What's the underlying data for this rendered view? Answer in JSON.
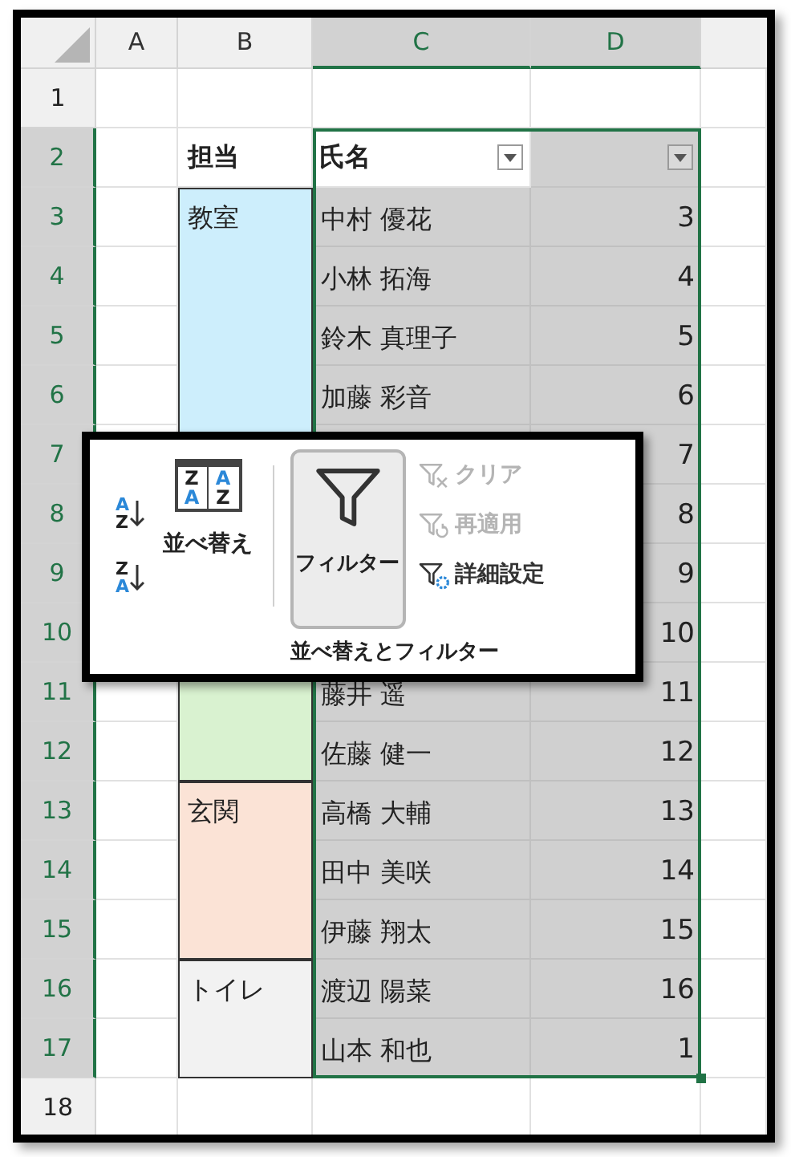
{
  "columns": [
    {
      "label": "A",
      "selected": false
    },
    {
      "label": "B",
      "selected": false
    },
    {
      "label": "C",
      "selected": true
    },
    {
      "label": "D",
      "selected": true
    }
  ],
  "rows": [
    {
      "label": "1",
      "selected": false
    },
    {
      "label": "2",
      "selected": true
    },
    {
      "label": "3",
      "selected": true
    },
    {
      "label": "4",
      "selected": true
    },
    {
      "label": "5",
      "selected": true
    },
    {
      "label": "6",
      "selected": true
    },
    {
      "label": "7",
      "selected": true
    },
    {
      "label": "8",
      "selected": true
    },
    {
      "label": "9",
      "selected": true
    },
    {
      "label": "10",
      "selected": true
    },
    {
      "label": "11",
      "selected": true
    },
    {
      "label": "12",
      "selected": true
    },
    {
      "label": "13",
      "selected": true
    },
    {
      "label": "14",
      "selected": true
    },
    {
      "label": "15",
      "selected": true
    },
    {
      "label": "16",
      "selected": true
    },
    {
      "label": "17",
      "selected": true
    },
    {
      "label": "18",
      "selected": false
    }
  ],
  "table_header": {
    "column_b": "担当",
    "column_c": "氏名"
  },
  "groups": [
    {
      "label": "教室",
      "color": "#cdeefc",
      "records": [
        {
          "name": "中村 優花",
          "number": "3"
        },
        {
          "name": "小林 拓海",
          "number": "4"
        },
        {
          "name": "鈴木 真理子",
          "number": "5"
        },
        {
          "name": "加藤 彩音",
          "number": "6"
        },
        {
          "number": "7"
        }
      ]
    },
    {
      "color": "#d9f2d0",
      "records": [
        {
          "number": "8"
        },
        {
          "number": "9"
        },
        {
          "number": "10"
        },
        {
          "name": "藤井 遥",
          "number": "11"
        },
        {
          "name": "佐藤 健一",
          "number": "12"
        }
      ]
    },
    {
      "label": "玄関",
      "color": "#fbe3d6",
      "records": [
        {
          "name": "高橋 大輔",
          "number": "13"
        },
        {
          "name": "田中 美咲",
          "number": "14"
        },
        {
          "name": "伊藤 翔太",
          "number": "15"
        }
      ]
    },
    {
      "label": "トイレ",
      "color": "#f2f2f2",
      "records": [
        {
          "name": "渡辺 陽菜",
          "number": "16"
        },
        {
          "name": "山本 和也",
          "number": "1"
        }
      ]
    }
  ],
  "ribbon": {
    "sort_ascending_icon": [
      "A",
      "Z"
    ],
    "sort_descending_icon": [
      "Z",
      "A"
    ],
    "sort_icon": [
      "Z",
      "A",
      "A",
      "Z"
    ],
    "sort_button": "並べ替え",
    "filter_button": {
      "label": "フィルター",
      "selected": true
    },
    "side_buttons": [
      {
        "kind": "clear",
        "label": "クリア",
        "disabled": true
      },
      {
        "kind": "reapply",
        "label": "再適用",
        "disabled": true
      },
      {
        "kind": "advanced",
        "label": "詳細設定",
        "disabled": false
      }
    ],
    "group_label": "並べ替えとフィルター"
  }
}
